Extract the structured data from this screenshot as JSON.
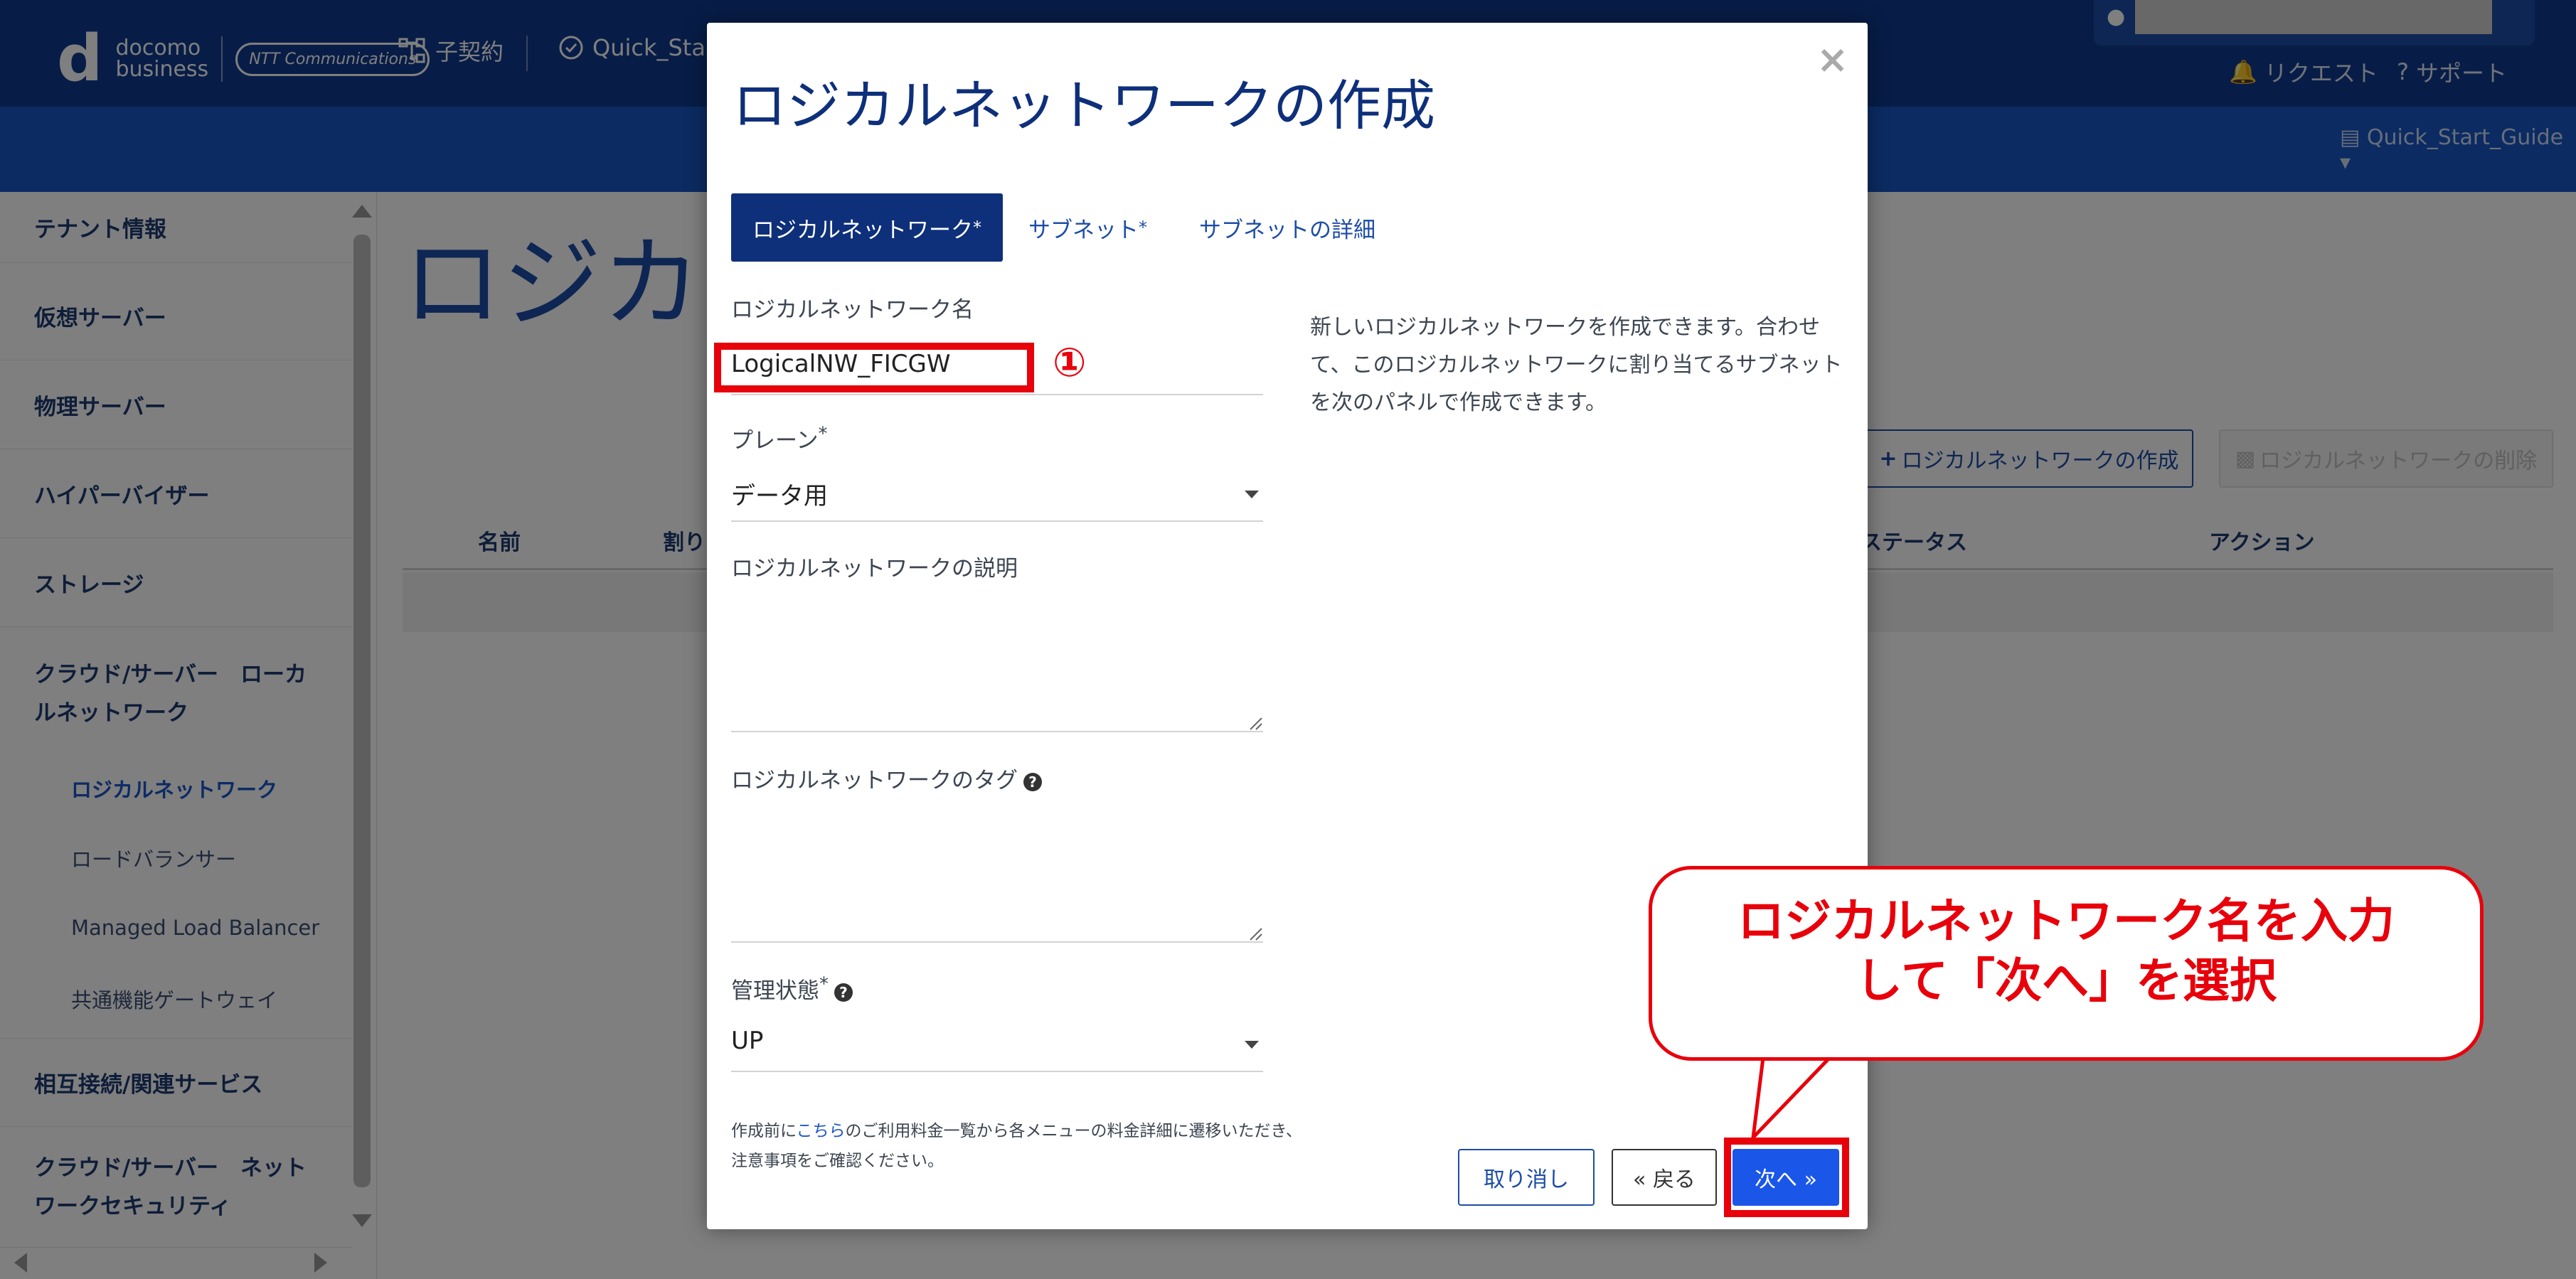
{
  "header": {
    "logo_top": "docomo",
    "logo_bottom": "business",
    "logo_partner": "NTT Communications",
    "nav_contract": "子契約",
    "nav_guide": "Quick_Sta",
    "request": "リクエスト",
    "support": "サポート",
    "tenant": "Quick_Start_Guide"
  },
  "sidebar": {
    "items": [
      {
        "label": "テナント情報"
      },
      {
        "label": "仮想サーバー"
      },
      {
        "label": "物理サーバー"
      },
      {
        "label": "ハイパーバイザー"
      },
      {
        "label": "ストレージ"
      },
      {
        "label_line1": "クラウド/サーバー　ローカ",
        "label_line2": "ルネットワーク"
      },
      {
        "label": "相互接続/関連サービス"
      },
      {
        "label_line1": "クラウド/サーバー　ネット",
        "label_line2": "ワークセキュリティ"
      }
    ],
    "subitems": [
      {
        "label": "ロジカルネットワーク",
        "active": true
      },
      {
        "label": "ロードバランサー"
      },
      {
        "label": "Managed Load Balancer"
      },
      {
        "label": "共通機能ゲートウェイ"
      }
    ]
  },
  "main": {
    "title_partial": "ロジカル",
    "create_button": "ロジカルネットワークの作成",
    "delete_button": "ロジカルネットワークの削除",
    "columns": {
      "name": "名前",
      "assign": "割り",
      "status": "ステータス",
      "action": "アクション"
    }
  },
  "modal": {
    "title": "ロジカルネットワークの作成",
    "close": "×",
    "tabs": [
      {
        "label": "ロジカルネットワーク",
        "required": "*",
        "active": true
      },
      {
        "label": "サブネット",
        "required": "*"
      },
      {
        "label": "サブネットの詳細"
      }
    ],
    "fields": {
      "name_label": "ロジカルネットワーク名",
      "name_value": "LogicalNW_FICGW",
      "plane_label": "プレーン",
      "plane_required": "*",
      "plane_value": "データ用",
      "description_label": "ロジカルネットワークの説明",
      "tags_label": "ロジカルネットワークのタグ",
      "admin_state_label": "管理状態",
      "admin_state_required": "*",
      "admin_state_value": "UP"
    },
    "marker": "①",
    "description": "新しいロジカルネットワークを作成できます。合わせて、このロジカルネットワークに割り当てるサブネットを次のパネルで作成できます。",
    "note_before": "作成前に",
    "note_link": "こちら",
    "note_after": "のご利用料金一覧から各メニューの料金詳細に遷移いただき、注意事項をご確認ください。",
    "buttons": {
      "cancel": "取り消し",
      "back": "« 戻る",
      "next": "次へ »"
    }
  },
  "callout": {
    "line1": "ロジカルネットワーク名を入力",
    "line2": "して「次へ」を選択"
  },
  "colors": {
    "header": "#0f3a8f",
    "accent": "#1a56e8",
    "highlight": "#e8000b"
  }
}
